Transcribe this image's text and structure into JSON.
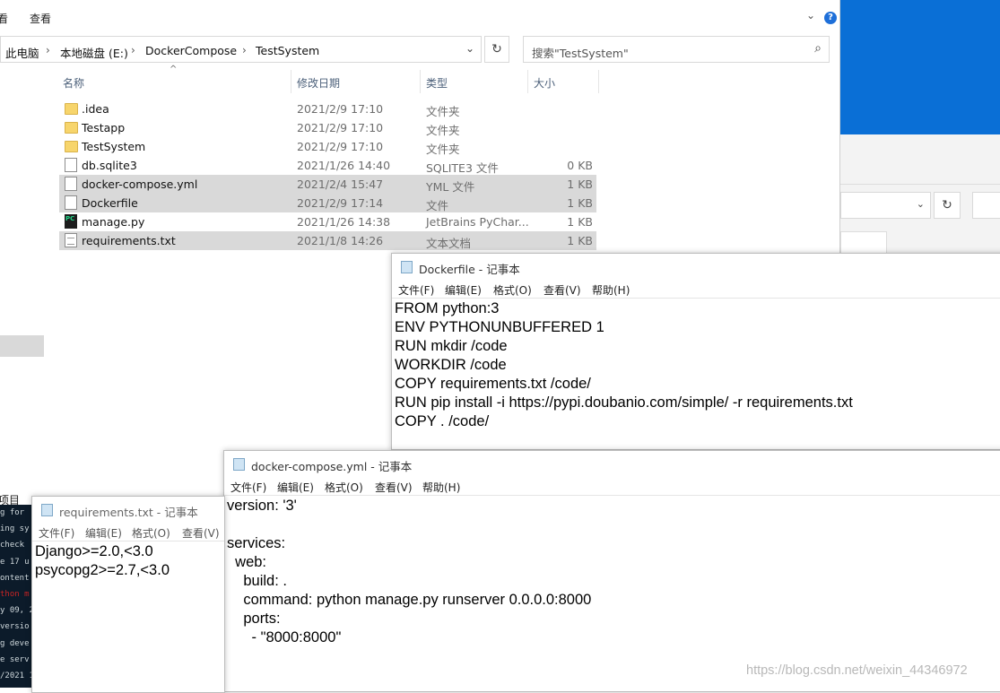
{
  "explorer": {
    "ribbon_tabs": [
      "查看"
    ],
    "ribbon_partial": "看",
    "breadcrumb": [
      "此电脑",
      "本地磁盘 (E:)",
      "DockerCompose",
      "TestSystem"
    ],
    "search_placeholder": "搜索\"TestSystem\"",
    "columns": {
      "name": "名称",
      "date": "修改日期",
      "type": "类型",
      "size": "大小"
    },
    "files": [
      {
        "icon": "folder-icon",
        "name": ".idea",
        "date": "2021/2/9 17:10",
        "type": "文件夹",
        "size": "",
        "selected": false
      },
      {
        "icon": "folder-icon",
        "name": "Testapp",
        "date": "2021/2/9 17:10",
        "type": "文件夹",
        "size": "",
        "selected": false
      },
      {
        "icon": "folder-icon",
        "name": "TestSystem",
        "date": "2021/2/9 17:10",
        "type": "文件夹",
        "size": "",
        "selected": false
      },
      {
        "icon": "file-icon",
        "name": "db.sqlite3",
        "date": "2021/1/26 14:40",
        "type": "SQLITE3 文件",
        "size": "0 KB",
        "selected": false
      },
      {
        "icon": "file-icon",
        "name": "docker-compose.yml",
        "date": "2021/2/4 15:47",
        "type": "YML 文件",
        "size": "1 KB",
        "selected": true
      },
      {
        "icon": "file-icon",
        "name": "Dockerfile",
        "date": "2021/2/9 17:14",
        "type": "文件",
        "size": "1 KB",
        "selected": true
      },
      {
        "icon": "pycharm-icon",
        "name": "manage.py",
        "date": "2021/1/26 14:38",
        "type": "JetBrains PyChar...",
        "size": "1 KB",
        "selected": false
      },
      {
        "icon": "text-file-icon",
        "name": "requirements.txt",
        "date": "2021/1/8 14:26",
        "type": "文本文档",
        "size": "1 KB",
        "selected": true
      }
    ]
  },
  "notepad_menu": [
    "文件(F)",
    "编辑(E)",
    "格式(O)",
    "查看(V)",
    "帮助(H)"
  ],
  "dockerfile": {
    "title": "Dockerfile - 记事本",
    "content": "FROM python:3\nENV PYTHONUNBUFFERED 1\nRUN mkdir /code\nWORKDIR /code\nCOPY requirements.txt /code/\nRUN pip install -i https://pypi.doubanio.com/simple/ -r requirements.txt\nCOPY . /code/"
  },
  "compose": {
    "title": "docker-compose.yml - 记事本",
    "content": "version: '3'\n\nservices:\n  web:\n    build: .\n    command: python manage.py runserver 0.0.0.0:8000\n    ports:\n      - \"8000:8000\""
  },
  "requirements": {
    "title": "requirements.txt - 记事本",
    "content": "Django>=2.0,<3.0\npsycopg2>=2.7,<3.0"
  },
  "terminal": {
    "project_label": "项目",
    "lines": [
      "g for",
      "ing sy",
      "check",
      "e 17 u",
      "ontent",
      "thon m",
      "y 09, 2",
      "versio",
      "g deve",
      "e serv",
      "/2021 1"
    ],
    "red_line_index": 5
  },
  "watermark": "https://blog.csdn.net/weixin_44346972"
}
